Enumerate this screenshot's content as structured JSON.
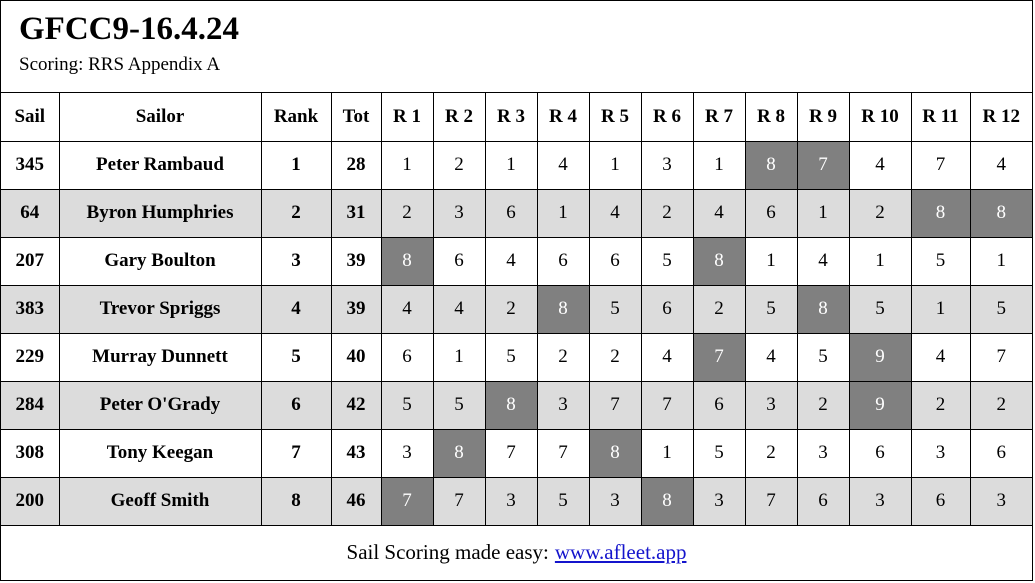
{
  "header": {
    "title": "GFCC9-16.4.24",
    "subtitle": "Scoring: RRS Appendix A"
  },
  "table": {
    "columns": [
      "Sail",
      "Sailor",
      "Rank",
      "Tot",
      "R 1",
      "R 2",
      "R 3",
      "R 4",
      "R 5",
      "R 6",
      "R 7",
      "R 8",
      "R 9",
      "R 10",
      "R 11",
      "R 12"
    ],
    "rows": [
      {
        "sail": "345",
        "sailor": "Peter Rambaud",
        "rank": "1",
        "tot": "28",
        "races": [
          "1",
          "2",
          "1",
          "4",
          "1",
          "3",
          "1",
          "8",
          "7",
          "4",
          "7",
          "4"
        ],
        "discards": [
          false,
          false,
          false,
          false,
          false,
          false,
          false,
          true,
          true,
          false,
          false,
          false
        ]
      },
      {
        "sail": "64",
        "sailor": "Byron Humphries",
        "rank": "2",
        "tot": "31",
        "races": [
          "2",
          "3",
          "6",
          "1",
          "4",
          "2",
          "4",
          "6",
          "1",
          "2",
          "8",
          "8"
        ],
        "discards": [
          false,
          false,
          false,
          false,
          false,
          false,
          false,
          false,
          false,
          false,
          true,
          true
        ]
      },
      {
        "sail": "207",
        "sailor": "Gary Boulton",
        "rank": "3",
        "tot": "39",
        "races": [
          "8",
          "6",
          "4",
          "6",
          "6",
          "5",
          "8",
          "1",
          "4",
          "1",
          "5",
          "1"
        ],
        "discards": [
          true,
          false,
          false,
          false,
          false,
          false,
          true,
          false,
          false,
          false,
          false,
          false
        ]
      },
      {
        "sail": "383",
        "sailor": "Trevor Spriggs",
        "rank": "4",
        "tot": "39",
        "races": [
          "4",
          "4",
          "2",
          "8",
          "5",
          "6",
          "2",
          "5",
          "8",
          "5",
          "1",
          "5"
        ],
        "discards": [
          false,
          false,
          false,
          true,
          false,
          false,
          false,
          false,
          true,
          false,
          false,
          false
        ]
      },
      {
        "sail": "229",
        "sailor": "Murray Dunnett",
        "rank": "5",
        "tot": "40",
        "races": [
          "6",
          "1",
          "5",
          "2",
          "2",
          "4",
          "7",
          "4",
          "5",
          "9",
          "4",
          "7"
        ],
        "discards": [
          false,
          false,
          false,
          false,
          false,
          false,
          true,
          false,
          false,
          true,
          false,
          false
        ]
      },
      {
        "sail": "284",
        "sailor": "Peter O'Grady",
        "rank": "6",
        "tot": "42",
        "races": [
          "5",
          "5",
          "8",
          "3",
          "7",
          "7",
          "6",
          "3",
          "2",
          "9",
          "2",
          "2"
        ],
        "discards": [
          false,
          false,
          true,
          false,
          false,
          false,
          false,
          false,
          false,
          true,
          false,
          false
        ]
      },
      {
        "sail": "308",
        "sailor": "Tony Keegan",
        "rank": "7",
        "tot": "43",
        "races": [
          "3",
          "8",
          "7",
          "7",
          "8",
          "1",
          "5",
          "2",
          "3",
          "6",
          "3",
          "6"
        ],
        "discards": [
          false,
          true,
          false,
          false,
          true,
          false,
          false,
          false,
          false,
          false,
          false,
          false
        ]
      },
      {
        "sail": "200",
        "sailor": "Geoff Smith",
        "rank": "8",
        "tot": "46",
        "races": [
          "7",
          "7",
          "3",
          "5",
          "3",
          "8",
          "3",
          "7",
          "6",
          "3",
          "6",
          "3"
        ],
        "discards": [
          true,
          false,
          false,
          false,
          false,
          true,
          false,
          false,
          false,
          false,
          false,
          false
        ]
      }
    ]
  },
  "footer": {
    "text": "Sail Scoring made easy:",
    "link_label": "www.afleet.app"
  },
  "colors": {
    "discard_bg": "#808080",
    "discard_fg": "#ffffff",
    "stripe_bg": "#dcdcdc",
    "link": "#1414cc"
  }
}
